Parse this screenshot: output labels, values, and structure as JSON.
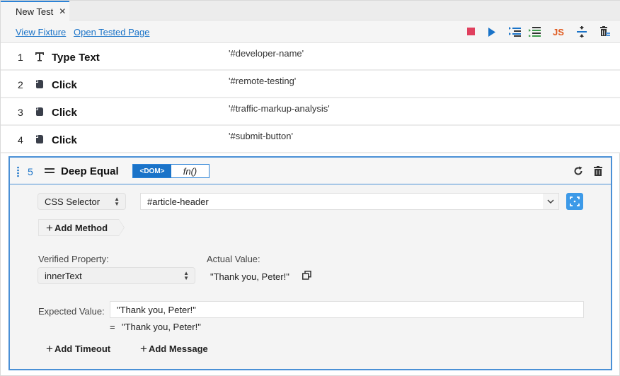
{
  "tab": {
    "title": "New Test",
    "close_icon": "close-icon"
  },
  "toolbar": {
    "links": [
      {
        "label": "View Fixture"
      },
      {
        "label": "Open Tested Page"
      }
    ],
    "icons": [
      {
        "name": "stop-icon",
        "color": "#e0405e"
      },
      {
        "name": "run-icon",
        "color": "#1a73c8"
      },
      {
        "name": "run-selected-icon",
        "color": "#1a73c8"
      },
      {
        "name": "run-marked-icon",
        "color": "#3a9a4a"
      },
      {
        "name": "js-icon",
        "label": "JS",
        "color": "#e05a1e"
      },
      {
        "name": "collapse-icon",
        "color": "#1a73c8"
      },
      {
        "name": "delete-all-icon",
        "color": "#333333"
      }
    ]
  },
  "steps": [
    {
      "num": "1",
      "icon": "type-text-icon",
      "name": "Type Text",
      "arg": "'#developer-name'"
    },
    {
      "num": "2",
      "icon": "click-icon",
      "name": "Click",
      "arg": "'#remote-testing'"
    },
    {
      "num": "3",
      "icon": "click-icon",
      "name": "Click",
      "arg": "'#traffic-markup-analysis'"
    },
    {
      "num": "4",
      "icon": "click-icon",
      "name": "Click",
      "arg": "'#submit-button'"
    }
  ],
  "expanded_step": {
    "num": "5",
    "name": "Deep Equal",
    "toggle": {
      "dom_label": "<DOM>",
      "fn_label": "fn()",
      "selected": "dom"
    },
    "selector_type": "CSS Selector",
    "selector_value": "#article-header",
    "add_method_label": "Add Method",
    "verified_property_label": "Verified Property:",
    "verified_property_value": "innerText",
    "actual_value_label": "Actual Value:",
    "actual_value": "\"Thank you, Peter!\"",
    "expected_value_label": "Expected Value:",
    "expected_value": "\"Thank you, Peter!\"",
    "evaluated_prefix": "=",
    "evaluated_value": "\"Thank you, Peter!\"",
    "add_timeout_label": "Add Timeout",
    "add_message_label": "Add Message"
  }
}
